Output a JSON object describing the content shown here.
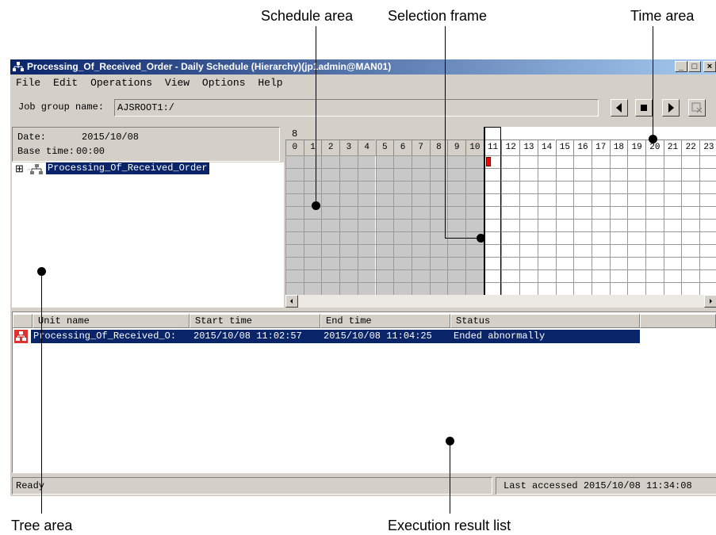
{
  "callouts": {
    "schedule_area": "Schedule area",
    "selection_frame": "Selection frame",
    "time_area": "Time area",
    "tree_area": "Tree area",
    "execution_result_list": "Execution result list"
  },
  "window": {
    "title": "Processing_Of_Received_Order - Daily Schedule (Hierarchy)(jp1admin@MAN01)",
    "controls": [
      "_",
      "□",
      "×"
    ]
  },
  "menu": [
    "File",
    "Edit",
    "Operations",
    "View",
    "Options",
    "Help"
  ],
  "job_group": {
    "label": "Job group name:",
    "value": "AJSROOT1:/"
  },
  "date_panel": {
    "date_label": "Date:",
    "date_value": "2015/10/08",
    "base_time_label": "Base time:",
    "base_time_value": "00:00"
  },
  "tree": {
    "expander": "⊞",
    "item": "Processing_Of_Received_Order"
  },
  "schedule": {
    "day": "8",
    "hours": [
      "0",
      "1",
      "2",
      "3",
      "4",
      "5",
      "6",
      "7",
      "8",
      "9",
      "10",
      "11",
      "12",
      "13",
      "14",
      "15",
      "16",
      "17",
      "18",
      "19",
      "20",
      "21",
      "22",
      "23"
    ],
    "selected_hour": "11",
    "past_color": "#c8c8c8",
    "future_color": "#ffffff",
    "marker_color": "#ff0000"
  },
  "result_list": {
    "columns": [
      "Unit name",
      "Start time",
      "End time",
      "Status"
    ],
    "rows": [
      {
        "unit_name": "Processing_Of_Received_O:",
        "start_time": "2015/10/08 11:02:57",
        "end_time": "2015/10/08 11:04:25",
        "status": "Ended abnormally"
      }
    ],
    "selection_color": "#0a246a"
  },
  "status_bar": {
    "left": "Ready",
    "right": "Last accessed 2015/10/08 11:34:08"
  }
}
